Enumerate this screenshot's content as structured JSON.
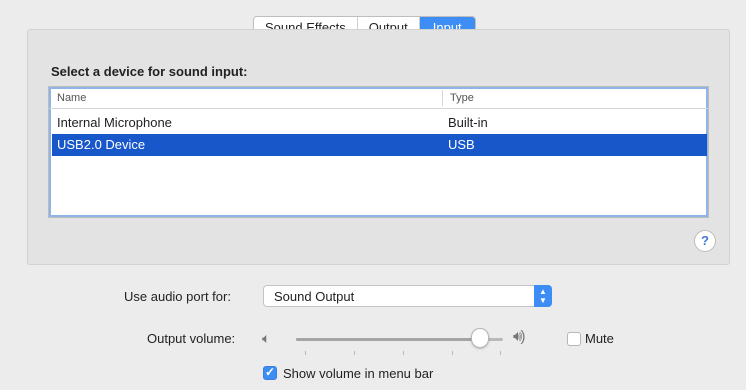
{
  "tabs": [
    {
      "label": "Sound Effects",
      "active": false
    },
    {
      "label": "Output",
      "active": false
    },
    {
      "label": "Input",
      "active": true
    }
  ],
  "input": {
    "title": "Select a device for sound input:",
    "columns": {
      "name": "Name",
      "type": "Type"
    },
    "devices": [
      {
        "name": "Internal Microphone",
        "type": "Built-in",
        "selected": false
      },
      {
        "name": "USB2.0 Device",
        "type": "USB",
        "selected": true
      }
    ]
  },
  "help": {
    "icon": "question-mark-icon",
    "glyph": "?"
  },
  "audio_port": {
    "label": "Use audio port for:",
    "value": "Sound Output"
  },
  "output_volume": {
    "label": "Output volume:",
    "level": 0.9,
    "mute_label": "Mute",
    "muted": false
  },
  "menu_bar": {
    "label": "Show volume in menu bar",
    "checked": true
  },
  "colors": {
    "accent": "#3e8df5",
    "selection": "#1757c9"
  }
}
